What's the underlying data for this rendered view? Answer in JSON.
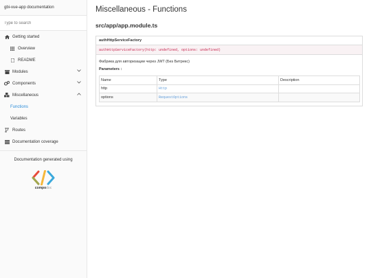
{
  "app": {
    "title": "gbi-vue-app documentation"
  },
  "search": {
    "placeholder": "Type to search"
  },
  "sidebar": {
    "getting_started": "Getting started",
    "overview": "Overview",
    "readme": "README",
    "modules": "Modules",
    "components": "Components",
    "miscellaneous": "Miscellaneous",
    "functions": "Functions",
    "variables": "Variables",
    "routes": "Routes",
    "coverage": "Documentation coverage",
    "generated_using": "Documentation generated using",
    "logo_text_bold": "compo",
    "logo_text_light": "doc"
  },
  "main": {
    "title": "Miscellaneous - Functions",
    "file_path": "src/app/app.module.ts",
    "function": {
      "name": "authHttpServiceFactory",
      "signature": "authHttpServiceFactory(http: undefined, options: undefined)",
      "description": "Фабрика для авторизации через JWT (Без Битрекс)",
      "params_label": "Parameters :",
      "columns": [
        "Name",
        "Type",
        "Description"
      ],
      "params": [
        {
          "name": "http",
          "type": "Http",
          "description": ""
        },
        {
          "name": "options",
          "type": "RequestOptions",
          "description": ""
        }
      ]
    }
  },
  "colors": {
    "active_link": "#2a8bd8",
    "signature": "#c7254e",
    "type_link": "#5d9ad8"
  }
}
